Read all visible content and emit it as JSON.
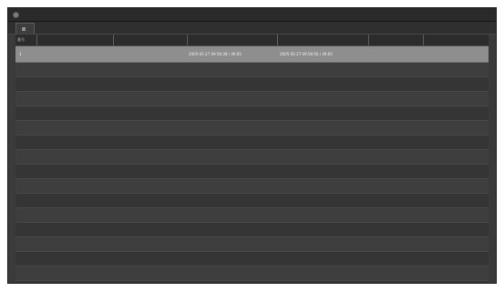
{
  "window": {
    "title": ""
  },
  "tab": {
    "label": ""
  },
  "table": {
    "columns": [
      "番号",
      "",
      "",
      "",
      "",
      "",
      ""
    ],
    "rows": [
      [
        "1",
        "",
        "",
        "2005-05-27 09:56:38 / 49:05",
        "2005-05-27 09:56:56 / 49:05",
        "",
        ""
      ]
    ]
  }
}
